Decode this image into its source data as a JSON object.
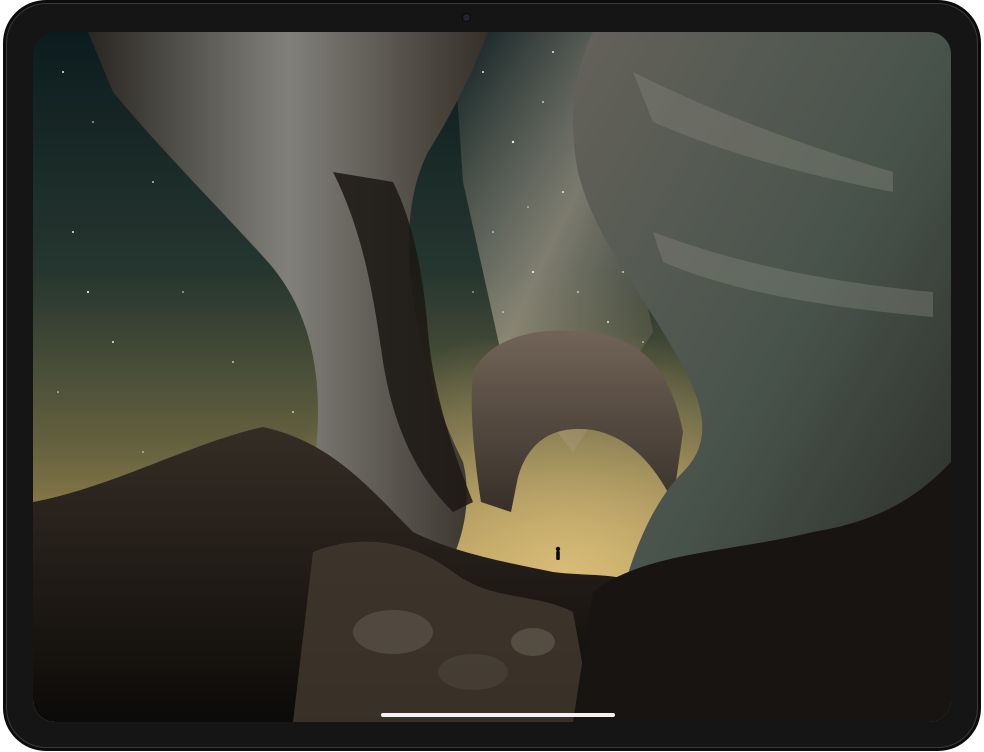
{
  "device": {
    "type": "tablet",
    "orientation": "landscape",
    "bezel_color": "#151516"
  },
  "screen": {
    "content": "photo-wallpaper",
    "colors": {
      "sky_top": "#0f2220",
      "sky_horizon": "#c8a65a",
      "rock_lit": "#8a8a82",
      "rock_shadow": "#1e1a16"
    }
  },
  "home_indicator": {
    "color": "#f2f2f2"
  }
}
